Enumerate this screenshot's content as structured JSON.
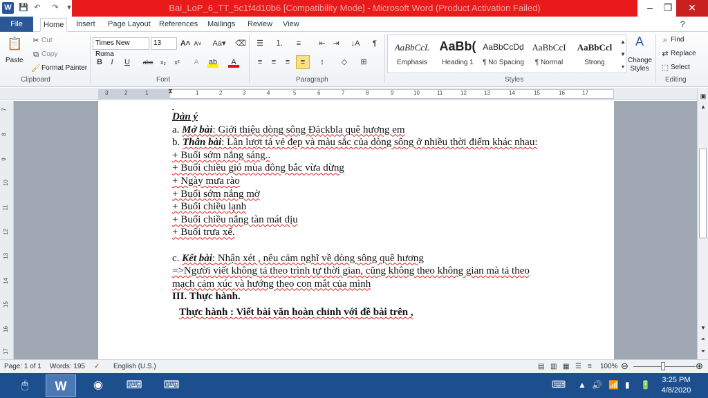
{
  "window": {
    "title": "Bai_LoP_6_TT_5c1f4d10b6 [Compatibility Mode] - Microsoft Word (Product Activation Failed)",
    "minimize": "–",
    "restore": "❐",
    "close": "✕"
  },
  "tabs": [
    "File",
    "Home",
    "Insert",
    "Page Layout",
    "References",
    "Mailings",
    "Review",
    "View"
  ],
  "ribbon": {
    "clipboard": {
      "paste": "Paste",
      "cut": "Cut",
      "copy": "Copy",
      "format_painter": "Format Painter",
      "label": "Clipboard"
    },
    "font": {
      "family": "Times New Roma",
      "size": "13",
      "label": "Font"
    },
    "paragraph": {
      "label": "Paragraph"
    },
    "styles": {
      "items": [
        {
          "preview": "AaBbCcL",
          "name": "Emphasis"
        },
        {
          "preview": "AaBb(",
          "name": "Heading 1"
        },
        {
          "preview": "AaBbCcDd",
          "name": "¶ No Spacing"
        },
        {
          "preview": "AaBbCcI",
          "name": "¶ Normal"
        },
        {
          "preview": "AaBbCcl",
          "name": "Strong"
        }
      ],
      "change_styles": "Change Styles",
      "label": "Styles"
    },
    "editing": {
      "find": "Find",
      "replace": "Replace",
      "select": "Select",
      "label": "Editing"
    }
  },
  "ruler": {
    "numbers": [
      "3",
      "2",
      "1",
      "",
      "1",
      "2",
      "3",
      "4",
      "5",
      "6",
      "7",
      "8",
      "9",
      "10",
      "11",
      "12",
      "13",
      "14",
      "15",
      "16",
      "17"
    ],
    "vertical": [
      "7",
      "8",
      "9",
      "10",
      "11",
      "12",
      "13",
      "14",
      "15",
      "16",
      "17"
    ]
  },
  "document": {
    "lines": {
      "dan_y": "Dàn ý",
      "mo_bai_prefix": "a. ",
      "mo_bai_label": "Mở bài",
      "mo_bai_text": ":  Giới thiệu dòng sông Đăckbla quê hương em",
      "than_bai_prefix": "b. ",
      "than_bai_label": "Thân bài",
      "than_bai_text": ": Lần lượt tả vẻ đẹp và màu sắc của dòng sông ở nhiều thời điểm khác nhau:",
      "items": [
        " + Buổi sớm nắng sáng..",
        " + Buổi chiều gió mùa đông bắc vừa dừng",
        " + Ngày mưa rào",
        " + Buổi sớm nắng mờ",
        " + Buổi chiều lạnh",
        " + Buổi chiều nắng tàn mát dịu",
        " + Buổi trưa xế."
      ],
      "ket_bai_prefix": "c. ",
      "ket_bai_label": "Kết bài",
      "ket_bai_text": ": Nhận xét , nêu cảm nghĩ về dòng sông quê hương",
      "note1": "=>Người viết không tả theo trình tự thời gian, cũng không theo không gian mà tả theo",
      "note2": "mạch cảm xúc và hướng theo con mắt của mình",
      "section3": "III. Thực hành.",
      "practice": "Thực hành : Viết  bài văn hoàn chỉnh với đề bài trên  ,"
    }
  },
  "status": {
    "page": "Page: 1 of 1",
    "words": "Words: 195",
    "lang": "English (U.S.)",
    "zoom": "100%"
  },
  "taskbar": {
    "time": "3:25 PM",
    "date": "4/8/2020"
  }
}
